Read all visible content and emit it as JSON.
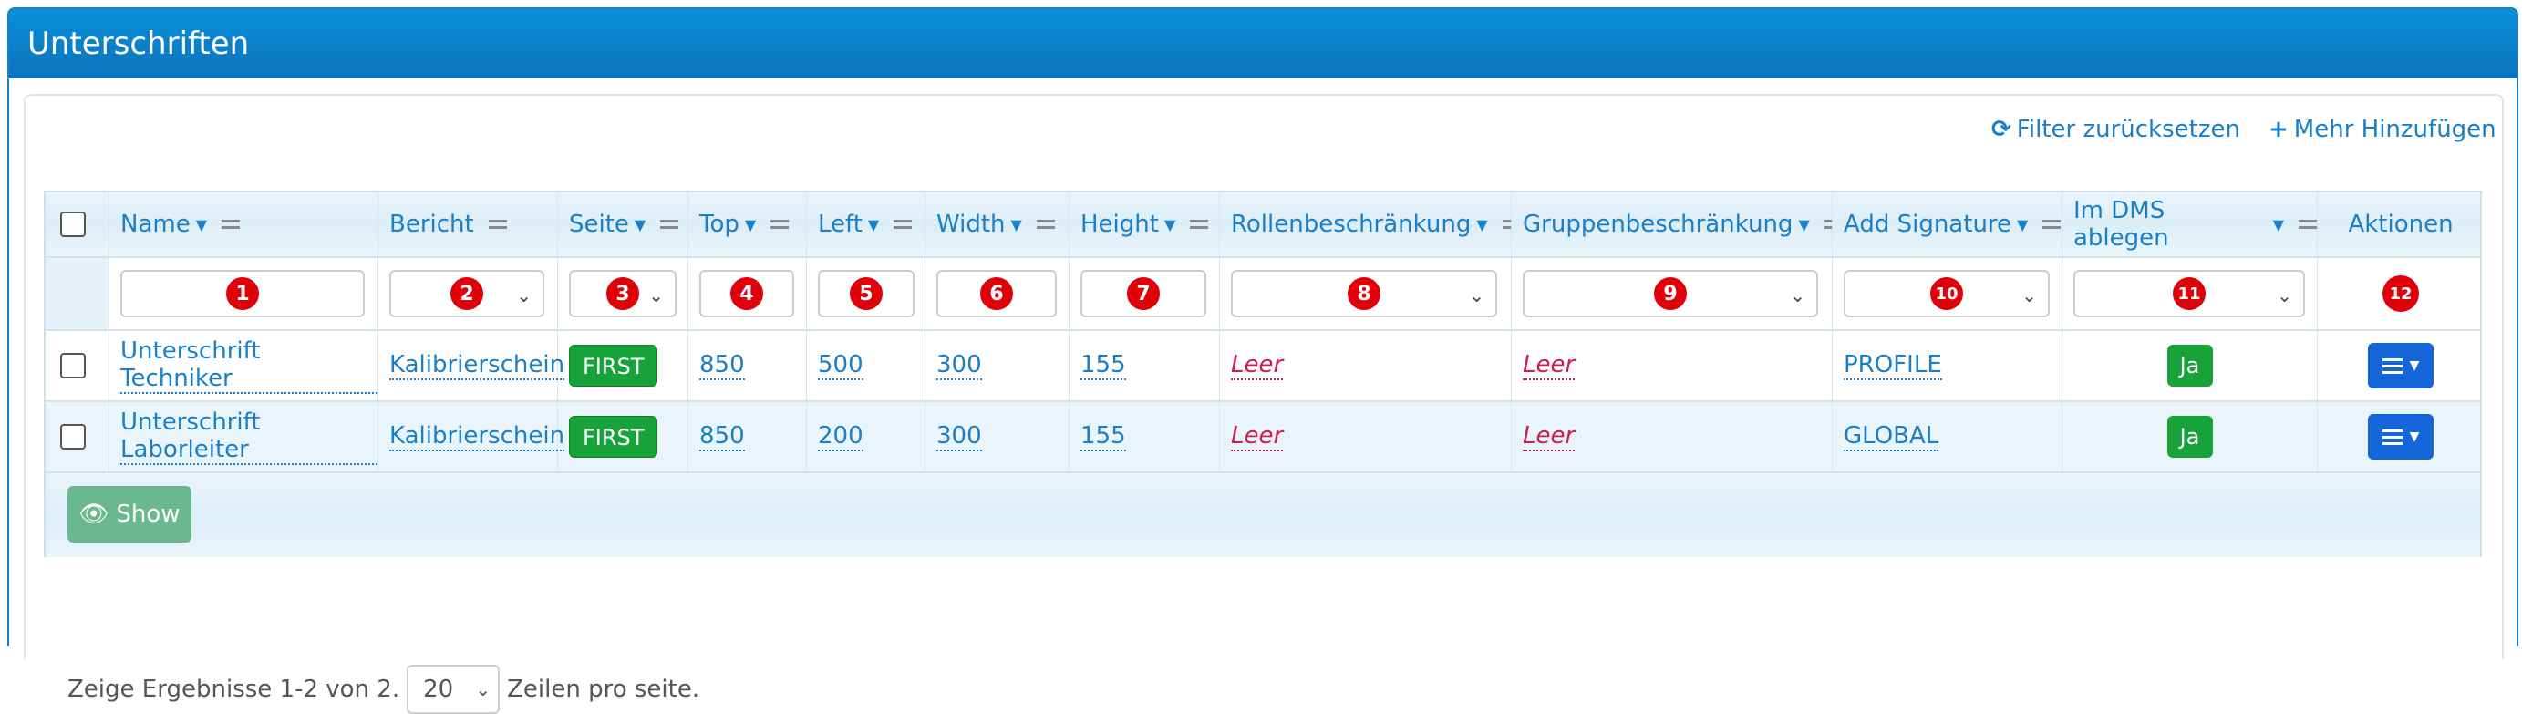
{
  "panel": {
    "title": "Unterschriften"
  },
  "toolbar": {
    "reset_icon": "refresh-icon",
    "reset_label": "Filter zurücksetzen",
    "add_icon": "plus-icon",
    "add_label": "Mehr Hinzufügen"
  },
  "columns": [
    {
      "label": "Name"
    },
    {
      "label": "Bericht"
    },
    {
      "label": "Seite"
    },
    {
      "label": "Top"
    },
    {
      "label": "Left"
    },
    {
      "label": "Width"
    },
    {
      "label": "Height"
    },
    {
      "label": "Rollenbeschränkung"
    },
    {
      "label": "Gruppenbeschränkung"
    },
    {
      "label": "Add Signature"
    },
    {
      "label": "Im DMS ablegen"
    },
    {
      "label": "Aktionen"
    }
  ],
  "filter_badges": [
    "1",
    "2",
    "3",
    "4",
    "5",
    "6",
    "7",
    "8",
    "9",
    "10",
    "11",
    "12"
  ],
  "rows": [
    {
      "name": "Unterschrift Techniker",
      "bericht": "Kalibrierschein",
      "seite": "FIRST",
      "top": "850",
      "left": "500",
      "width": "300",
      "height": "155",
      "rolle": "Leer",
      "gruppe": "Leer",
      "signature": "PROFILE",
      "dms": "Ja"
    },
    {
      "name": "Unterschrift Laborleiter",
      "bericht": "Kalibrierschein",
      "seite": "FIRST",
      "top": "850",
      "left": "200",
      "width": "300",
      "height": "155",
      "rolle": "Leer",
      "gruppe": "Leer",
      "signature": "GLOBAL",
      "dms": "Ja"
    }
  ],
  "show_button": {
    "label": "Show",
    "icon": "eye-icon"
  },
  "pager": {
    "summary": "Zeige Ergebnisse 1-2 von 2.",
    "page_size": "20",
    "suffix": "Zeilen pro seite."
  },
  "colors": {
    "accent": "#1a7fc7",
    "header": "#0a86d0",
    "badge": "#e0000a",
    "success": "#18a33a",
    "empty": "#d21c4a",
    "action": "#1466d8"
  }
}
